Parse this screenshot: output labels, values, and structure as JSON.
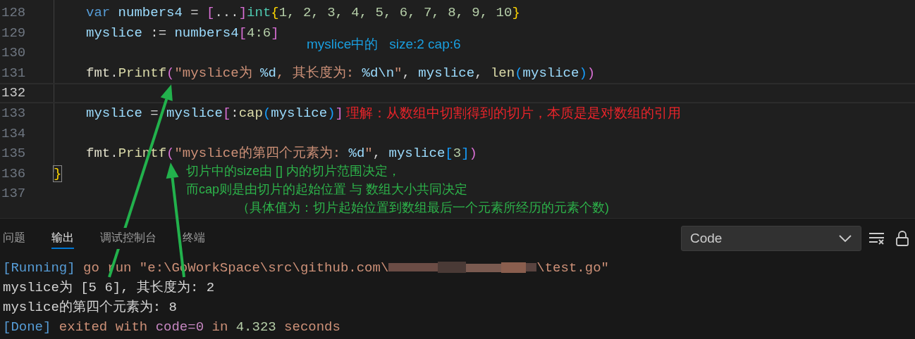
{
  "editor": {
    "lines": [
      {
        "number": "128",
        "current": false,
        "indented": true,
        "tokens": [
          {
            "text": "var",
            "kind": "keyword"
          },
          {
            "text": " numbers4 ",
            "kind": "variable"
          },
          {
            "text": "= ",
            "kind": "plain"
          },
          {
            "text": "[",
            "kind": "paren_pink"
          },
          {
            "text": "...",
            "kind": "plain"
          },
          {
            "text": "]",
            "kind": "paren_pink"
          },
          {
            "text": "int",
            "kind": "type"
          },
          {
            "text": "{",
            "kind": "paren_gold"
          },
          {
            "text": "1, 2, 3, 4, 5, 6, 7, 8, 9, 10",
            "kind": "number"
          },
          {
            "text": "}",
            "kind": "paren_gold"
          }
        ]
      },
      {
        "number": "129",
        "current": false,
        "indented": true,
        "tokens": [
          {
            "text": "myslice",
            "kind": "variable"
          },
          {
            "text": " := ",
            "kind": "plain"
          },
          {
            "text": "numbers4",
            "kind": "variable"
          },
          {
            "text": "[",
            "kind": "paren_pink"
          },
          {
            "text": "4:6",
            "kind": "number"
          },
          {
            "text": "]",
            "kind": "paren_pink"
          }
        ],
        "note": {
          "kind": "aside",
          "text": "myslice中的   size:2 cap:6",
          "color": "#1a9fe0"
        }
      },
      {
        "number": "130",
        "current": false
      },
      {
        "number": "131",
        "current": false,
        "indented": true,
        "tokens": [
          {
            "text": "fmt",
            "kind": "package"
          },
          {
            "text": ".",
            "kind": "plain"
          },
          {
            "text": "Printf",
            "kind": "function"
          },
          {
            "text": "(",
            "kind": "paren_pink"
          },
          {
            "text": "\"myslice为 ",
            "kind": "string"
          },
          {
            "text": "%d",
            "kind": "format"
          },
          {
            "text": ", 其长度为: ",
            "kind": "string"
          },
          {
            "text": "%d\\n",
            "kind": "format"
          },
          {
            "text": "\"",
            "kind": "string"
          },
          {
            "text": ", ",
            "kind": "plain"
          },
          {
            "text": "myslice",
            "kind": "variable"
          },
          {
            "text": ", ",
            "kind": "plain"
          },
          {
            "text": "len",
            "kind": "function"
          },
          {
            "text": "(",
            "kind": "paren_blue"
          },
          {
            "text": "myslice",
            "kind": "variable"
          },
          {
            "text": ")",
            "kind": "paren_blue"
          },
          {
            "text": ")",
            "kind": "paren_pink"
          }
        ]
      },
      {
        "number": "132",
        "current": true
      },
      {
        "number": "133",
        "current": false,
        "indented": true,
        "tokens": [
          {
            "text": "myslice",
            "kind": "variable"
          },
          {
            "text": " = ",
            "kind": "plain"
          },
          {
            "text": "myslice",
            "kind": "variable"
          },
          {
            "text": "[",
            "kind": "paren_pink"
          },
          {
            "text": ":",
            "kind": "plain"
          },
          {
            "text": "cap",
            "kind": "function"
          },
          {
            "text": "(",
            "kind": "paren_blue"
          },
          {
            "text": "myslice",
            "kind": "variable"
          },
          {
            "text": ")",
            "kind": "paren_blue"
          },
          {
            "text": "]",
            "kind": "paren_pink"
          }
        ],
        "note": {
          "kind": "inline",
          "text": "理解：从数组中切割得到的切片，本质是是对数组的引用",
          "color": "#e8242a"
        }
      },
      {
        "number": "134",
        "current": false
      },
      {
        "number": "135",
        "current": false,
        "indented": true,
        "tokens": [
          {
            "text": "fmt",
            "kind": "package"
          },
          {
            "text": ".",
            "kind": "plain"
          },
          {
            "text": "Printf",
            "kind": "function"
          },
          {
            "text": "(",
            "kind": "paren_pink"
          },
          {
            "text": "\"myslice的第四个元素为: ",
            "kind": "string"
          },
          {
            "text": "%d",
            "kind": "format"
          },
          {
            "text": "\"",
            "kind": "string"
          },
          {
            "text": ", ",
            "kind": "plain"
          },
          {
            "text": "myslice",
            "kind": "variable"
          },
          {
            "text": "[",
            "kind": "paren_blue"
          },
          {
            "text": "3",
            "kind": "number"
          },
          {
            "text": "]",
            "kind": "paren_blue"
          },
          {
            "text": ")",
            "kind": "paren_pink"
          }
        ]
      },
      {
        "number": "136",
        "current": false,
        "indented": false,
        "tokens": [
          {
            "text": "}",
            "kind": "brace_matched"
          }
        ],
        "note": {
          "kind": "block",
          "color": "#2db34a",
          "lines": [
            {
              "text": "切片中的size由 [] 内的切片范围决定，",
              "indented": false
            },
            {
              "text": "而cap则是由切片的起始位置 与 数组大小共同决定",
              "indented": false
            },
            {
              "text": "（具体值为：切片起始位置到数组最后一个元素所经历的元素个数)",
              "indented": true
            }
          ]
        }
      },
      {
        "number": "137",
        "current": false
      }
    ]
  },
  "panel": {
    "tabs": [
      {
        "label": "问题",
        "selected": false
      },
      {
        "label": "输出",
        "selected": true
      },
      {
        "label": "调试控制台",
        "selected": false
      },
      {
        "label": "终端",
        "selected": false
      }
    ],
    "channel_select": {
      "value": "Code"
    },
    "output": [
      [
        {
          "text": "[Running]",
          "kind": "info"
        },
        {
          "text": " go run \"e:\\GoWorkSpace\\src\\github.com\\",
          "kind": "text"
        },
        {
          "kind": "redacted"
        },
        {
          "text": "\\test.go\"",
          "kind": "text"
        }
      ],
      [
        {
          "text": "myslice为 [5 6], 其长度为: 2",
          "kind": "plain"
        }
      ],
      [
        {
          "text": "myslice的第四个元素为: 8",
          "kind": "plain"
        }
      ],
      [
        {
          "text": "[Done]",
          "kind": "info"
        },
        {
          "text": " exited with ",
          "kind": "text"
        },
        {
          "text": "code=0",
          "kind": "keyword"
        },
        {
          "text": " in ",
          "kind": "text"
        },
        {
          "text": "4.323",
          "kind": "number"
        },
        {
          "text": " seconds",
          "kind": "text"
        }
      ]
    ]
  }
}
